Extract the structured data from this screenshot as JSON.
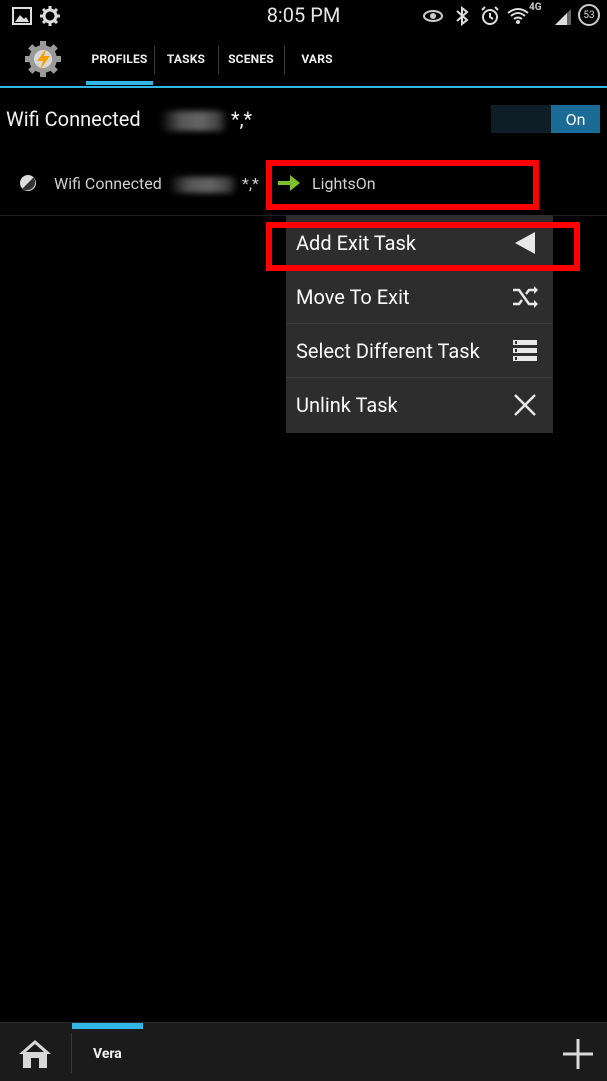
{
  "status_bar": {
    "time": "8:05 PM",
    "network": "4G",
    "battery": "53"
  },
  "tabs": [
    {
      "label": "PROFILES",
      "active": true
    },
    {
      "label": "TASKS",
      "active": false
    },
    {
      "label": "SCENES",
      "active": false
    },
    {
      "label": "VARS",
      "active": false
    }
  ],
  "profile": {
    "title_prefix": "Wifi Connected",
    "title_suffix": "*,*",
    "toggle_label": "On",
    "context_prefix": "Wifi Connected",
    "context_suffix": "*,*",
    "task_name": "LightsOn"
  },
  "context_menu": {
    "items": [
      {
        "label": "Add Exit Task",
        "icon": "back-triangle-icon"
      },
      {
        "label": "Move To Exit",
        "icon": "shuffle-icon"
      },
      {
        "label": "Select Different Task",
        "icon": "list-icon"
      },
      {
        "label": "Unlink Task",
        "icon": "close-icon"
      }
    ]
  },
  "bottom_bar": {
    "project_name": "Vera",
    "accent_color": "#33b5e5"
  }
}
